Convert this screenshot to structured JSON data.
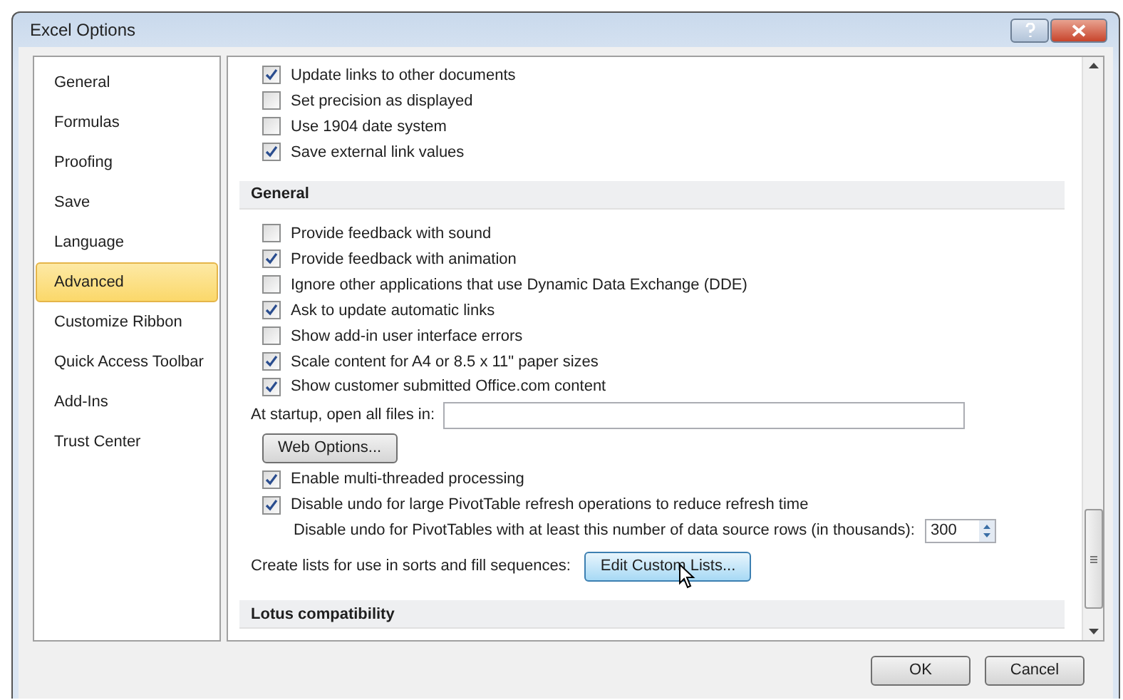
{
  "window": {
    "title": "Excel Options"
  },
  "sidebar": {
    "items": [
      {
        "label": "General",
        "selected": false
      },
      {
        "label": "Formulas",
        "selected": false
      },
      {
        "label": "Proofing",
        "selected": false
      },
      {
        "label": "Save",
        "selected": false
      },
      {
        "label": "Language",
        "selected": false
      },
      {
        "label": "Advanced",
        "selected": true
      },
      {
        "label": "Customize Ribbon",
        "selected": false
      },
      {
        "label": "Quick Access Toolbar",
        "selected": false
      },
      {
        "label": "Add-Ins",
        "selected": false
      },
      {
        "label": "Trust Center",
        "selected": false
      }
    ]
  },
  "content": [
    {
      "kind": "checkbox",
      "label": "Update links to other documents",
      "checked": true
    },
    {
      "kind": "checkbox",
      "label": "Set precision as displayed",
      "checked": false
    },
    {
      "kind": "checkbox",
      "label": "Use 1904 date system",
      "checked": false
    },
    {
      "kind": "checkbox",
      "label": "Save external link values",
      "checked": true
    },
    {
      "kind": "section",
      "label": "General"
    },
    {
      "kind": "checkbox",
      "label": "Provide feedback with sound",
      "checked": false
    },
    {
      "kind": "checkbox",
      "label": "Provide feedback with animation",
      "checked": true
    },
    {
      "kind": "checkbox",
      "label": "Ignore other applications that use Dynamic Data Exchange (DDE)",
      "checked": false
    },
    {
      "kind": "checkbox",
      "label": "Ask to update automatic links",
      "checked": true
    },
    {
      "kind": "checkbox",
      "label": "Show add-in user interface errors",
      "checked": false
    },
    {
      "kind": "checkbox",
      "label": "Scale content for A4 or 8.5 x 11\" paper sizes",
      "checked": true
    },
    {
      "kind": "checkbox",
      "label": "Show customer submitted Office.com content",
      "checked": true
    },
    {
      "kind": "field",
      "label": "At startup, open all files in:"
    },
    {
      "kind": "button",
      "label": "Web Options..."
    },
    {
      "kind": "checkbox",
      "label": "Enable multi-threaded processing",
      "checked": true
    },
    {
      "kind": "checkbox",
      "label": "Disable undo for large PivotTable refresh operations to reduce refresh time",
      "checked": true
    },
    {
      "kind": "spin",
      "label": "Disable undo for PivotTables with at least this number of data source rows (in thousands):",
      "value": "300"
    },
    {
      "kind": "action",
      "label": "Create lists for use in sorts and fill sequences:",
      "button": "Edit Custom Lists..."
    },
    {
      "kind": "section",
      "label": "Lotus compatibility"
    }
  ],
  "buttons": [
    "OK",
    "Cancel"
  ]
}
